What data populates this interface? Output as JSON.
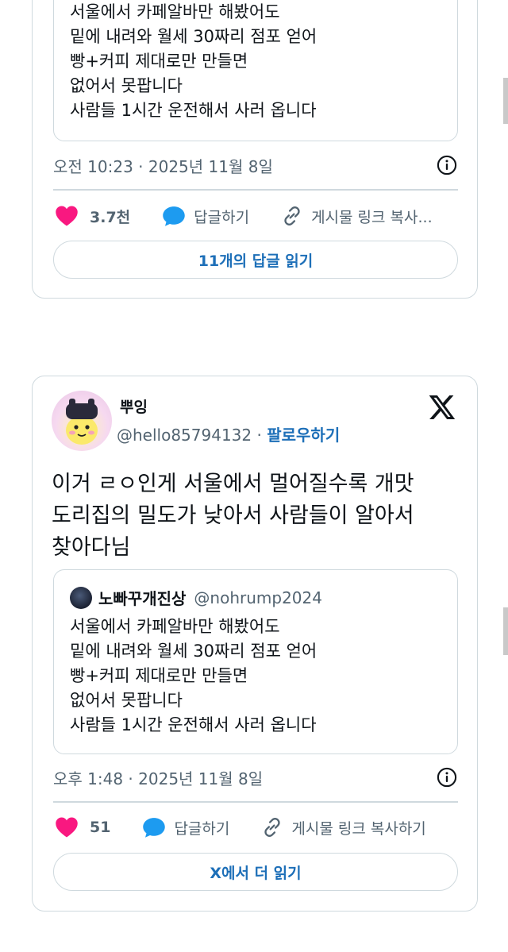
{
  "top_post": {
    "quote_lines": [
      "서울에서 카페알바만 해봤어도",
      "밑에 내려와 월세 30짜리 점포 얻어",
      "빵+커피 제대로만 만들면",
      "없어서 못팝니다",
      "사람들 1시간 운전해서 사러 옵니다"
    ],
    "timestamp": "오전 10:23 · 2025년 11월 8일",
    "like_count": "3.7천",
    "reply_label": "답글하기",
    "copy_link_label": "게시물 링크 복사...",
    "read_replies_label": "11개의 답글 읽기"
  },
  "bottom_post": {
    "display_name": "뿌잉",
    "handle": "@hello85794132",
    "separator": " · ",
    "follow_label": "팔로우하기",
    "text_lines": [
      "이거 ㄹㅇ인게 서울에서 멀어질수록 개맛",
      "도리집의 밀도가 낮아서 사람들이 알아서",
      "찾아다님"
    ],
    "quote": {
      "author_name": "노빠꾸개진상",
      "author_handle": "@nohrump2024",
      "lines": [
        "서울에서 카페알바만 해봤어도",
        "밑에 내려와 월세 30짜리 점포 얻어",
        "빵+커피 제대로만 만들면",
        "없어서 못팝니다",
        "사람들 1시간 운전해서 사러 옵니다"
      ]
    },
    "timestamp": "오후 1:48 · 2025년 11월 8일",
    "like_count": "51",
    "reply_label": "답글하기",
    "copy_link_label": "게시물 링크 복사하기",
    "read_more_label": "X에서 더 읽기"
  },
  "icons": {
    "like": "heart-icon",
    "reply": "chat-bubble-icon",
    "copy_link": "link-icon",
    "info": "info-icon",
    "brand": "x-logo-icon"
  },
  "colors": {
    "heart": "#f91880",
    "reply_bubble": "#1d9bf0",
    "link_blue": "#1d6fb8",
    "border": "#cfd9de",
    "muted_text": "#536471"
  }
}
